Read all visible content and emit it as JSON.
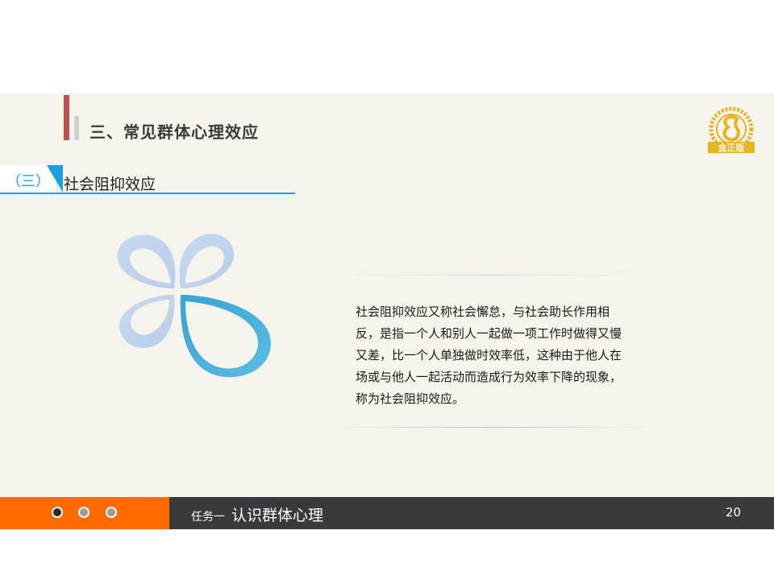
{
  "slide": {
    "title": "三、常见群体心理效应",
    "logo_text": "金正版"
  },
  "section": {
    "number": "（三）",
    "title": "社会阻抑效应"
  },
  "body": {
    "text": "社会阻抑效应又称社会懈怠，与社会助长作用相反，是指一个人和别人一起做一项工作时做得又慢又差，比一个人单独做时效率低，这种由于他人在场或与他人一起活动而造成行为效率下降的现象，称为社会阻抑效应。"
  },
  "footer": {
    "task_label": "任务一",
    "task_title": "认识群体心理",
    "page_number": "20"
  },
  "colors": {
    "accent_blue": "#1ba1e2",
    "footer_orange": "#ff6a00",
    "footer_dark": "#3a3a3c",
    "title_red": "#c0504d",
    "logo_gold": "#e6b422"
  }
}
